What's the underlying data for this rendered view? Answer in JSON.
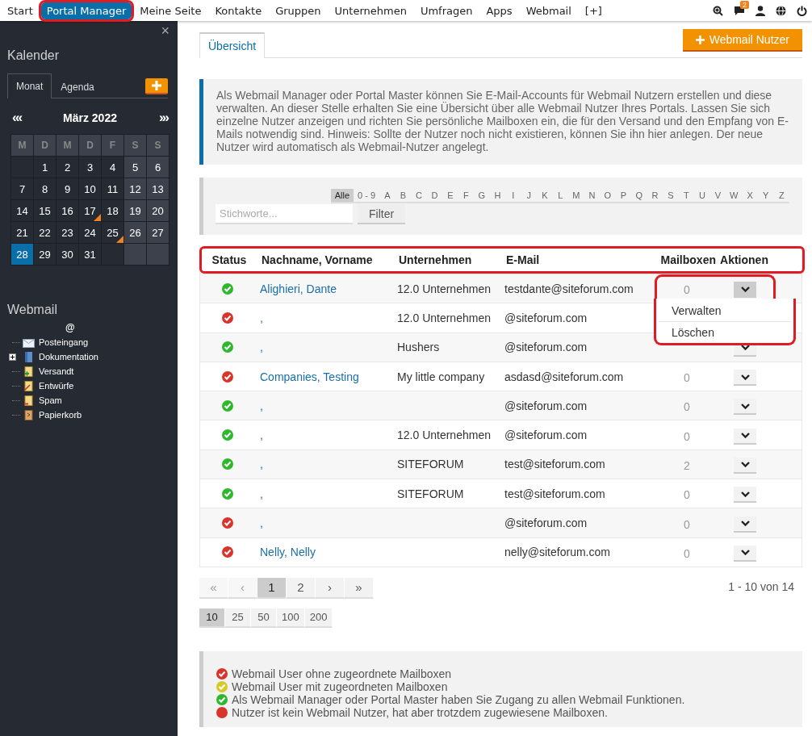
{
  "nav": {
    "items": [
      {
        "label": "Start",
        "selected": false
      },
      {
        "label": "Portal Manager",
        "selected": true,
        "highlighted": true
      },
      {
        "label": "Meine Seite",
        "selected": false
      },
      {
        "label": "Kontakte",
        "selected": false
      },
      {
        "label": "Gruppen",
        "selected": false
      },
      {
        "label": "Unternehmen",
        "selected": false
      },
      {
        "label": "Umfragen",
        "selected": false
      },
      {
        "label": "Apps",
        "selected": false
      },
      {
        "label": "Webmail",
        "selected": false
      },
      {
        "label": "[+]",
        "selected": false
      }
    ],
    "message_count": "2"
  },
  "sidebar": {
    "close": "×",
    "calendar": {
      "title": "Kalender",
      "tabs": [
        {
          "label": "Monat",
          "selected": true
        },
        {
          "label": "Agenda",
          "selected": false
        }
      ],
      "prev": "«‹",
      "month": "März 2022",
      "next": "›»",
      "weekdays": [
        "M",
        "D",
        "M",
        "D",
        "F",
        "S",
        "S"
      ],
      "weeks": [
        [
          {
            "kind": "blank"
          },
          {
            "kind": "day",
            "day": "1",
            "selected": false,
            "event": false
          },
          {
            "kind": "day",
            "day": "2",
            "selected": false,
            "event": false
          },
          {
            "kind": "day",
            "day": "3",
            "selected": false,
            "event": false
          },
          {
            "kind": "day",
            "day": "4",
            "selected": false,
            "event": false
          },
          {
            "kind": "day",
            "day": "5",
            "selected": false,
            "event": false
          },
          {
            "kind": "day",
            "day": "6",
            "selected": false,
            "event": false
          }
        ],
        [
          {
            "kind": "day",
            "day": "7",
            "selected": false,
            "event": false
          },
          {
            "kind": "day",
            "day": "8",
            "selected": false,
            "event": false
          },
          {
            "kind": "day",
            "day": "9",
            "selected": false,
            "event": false
          },
          {
            "kind": "day",
            "day": "10",
            "selected": false,
            "event": false
          },
          {
            "kind": "day",
            "day": "11",
            "selected": false,
            "event": false
          },
          {
            "kind": "day",
            "day": "12",
            "selected": false,
            "event": false
          },
          {
            "kind": "day",
            "day": "13",
            "selected": false,
            "event": false
          }
        ],
        [
          {
            "kind": "day",
            "day": "14",
            "selected": false,
            "event": false
          },
          {
            "kind": "day",
            "day": "15",
            "selected": false,
            "event": false
          },
          {
            "kind": "day",
            "day": "16",
            "selected": false,
            "event": false
          },
          {
            "kind": "day",
            "day": "17",
            "selected": false,
            "event": true
          },
          {
            "kind": "day",
            "day": "18",
            "selected": false,
            "event": false
          },
          {
            "kind": "day",
            "day": "19",
            "selected": false,
            "event": false
          },
          {
            "kind": "day",
            "day": "20",
            "selected": false,
            "event": false
          }
        ],
        [
          {
            "kind": "day",
            "day": "21",
            "selected": false,
            "event": false
          },
          {
            "kind": "day",
            "day": "22",
            "selected": false,
            "event": false
          },
          {
            "kind": "day",
            "day": "23",
            "selected": false,
            "event": false
          },
          {
            "kind": "day",
            "day": "24",
            "selected": false,
            "event": false
          },
          {
            "kind": "day",
            "day": "25",
            "selected": false,
            "event": true
          },
          {
            "kind": "day",
            "day": "26",
            "selected": false,
            "event": false
          },
          {
            "kind": "day",
            "day": "27",
            "selected": false,
            "event": false
          }
        ],
        [
          {
            "kind": "day",
            "day": "28",
            "selected": true,
            "event": false
          },
          {
            "kind": "day",
            "day": "29",
            "selected": false,
            "event": false
          },
          {
            "kind": "day",
            "day": "30",
            "selected": false,
            "event": false
          },
          {
            "kind": "day",
            "day": "31",
            "selected": false,
            "event": false
          },
          {
            "kind": "blank"
          },
          {
            "kind": "blank"
          },
          {
            "kind": "blank"
          }
        ]
      ]
    },
    "webmail": {
      "title": "Webmail",
      "root": "@",
      "folders": [
        {
          "label": "Posteingang",
          "kind": "inbox"
        },
        {
          "label": "Dokumentation",
          "kind": "docs",
          "expanded": false
        },
        {
          "label": "Versandt",
          "kind": "sent"
        },
        {
          "label": "Entwürfe",
          "kind": "drafts"
        },
        {
          "label": "Spam",
          "kind": "spam"
        },
        {
          "label": "Papierkorb",
          "kind": "trash"
        }
      ]
    }
  },
  "tabs": [
    {
      "label": "Übersicht",
      "selected": true
    }
  ],
  "add_button": "Webmail Nutzer",
  "description": "Als Webmail Manager oder Portal Master können Sie E-Mail-Accounts für Webmail Nutzern erstellen und diese verwalten. An dieser Stelle erhalten Sie eine Übersicht über alle Webmail Nutzer Ihres Portals. Lassen Sie sich einzelne Nutzer anzeigen und richten Sie persönliche Mailboxen ein, die für den Versand und den Empfang von E-Mails notwendig sind. Hinweis: Sollte der Nutzer noch nicht existieren, können Sie ihn hier anlegen. Der neue Nutzer wird automatisch als Webmail-Nutzer angelegt.",
  "alphabet": [
    {
      "label": "Alle",
      "selected": true
    },
    {
      "label": "0 - 9",
      "selected": false
    },
    {
      "label": "A",
      "selected": false
    },
    {
      "label": "B",
      "selected": false
    },
    {
      "label": "C",
      "selected": false
    },
    {
      "label": "D",
      "selected": false
    },
    {
      "label": "E",
      "selected": false
    },
    {
      "label": "F",
      "selected": false
    },
    {
      "label": "G",
      "selected": false
    },
    {
      "label": "H",
      "selected": false
    },
    {
      "label": "I",
      "selected": false
    },
    {
      "label": "J",
      "selected": false
    },
    {
      "label": "K",
      "selected": false
    },
    {
      "label": "L",
      "selected": false
    },
    {
      "label": "M",
      "selected": false
    },
    {
      "label": "N",
      "selected": false
    },
    {
      "label": "O",
      "selected": false
    },
    {
      "label": "P",
      "selected": false
    },
    {
      "label": "Q",
      "selected": false
    },
    {
      "label": "R",
      "selected": false
    },
    {
      "label": "S",
      "selected": false
    },
    {
      "label": "T",
      "selected": false
    },
    {
      "label": "U",
      "selected": false
    },
    {
      "label": "V",
      "selected": false
    },
    {
      "label": "W",
      "selected": false
    },
    {
      "label": "X",
      "selected": false
    },
    {
      "label": "Y",
      "selected": false
    },
    {
      "label": "Z",
      "selected": false
    }
  ],
  "search": {
    "placeholder": "Stichworte..."
  },
  "filter_button": "Filter",
  "table": {
    "columns": [
      "Status",
      "Nachname, Vorname",
      "Unternehmen",
      "E-Mail",
      "Mailboxen",
      "Aktionen"
    ],
    "rows": [
      {
        "color": "#2eb82e",
        "name": "Alighieri, Dante",
        "company": "12.0 Unternehmen",
        "email": "testdante@siteforum.com",
        "mailboxes": "0",
        "open": true
      },
      {
        "color": "#d9342b",
        "name": ",",
        "company": "12.0 Unternehmen",
        "email": "@siteforum.com"
      },
      {
        "color": "#2eb82e",
        "name": ",",
        "company": "Hushers",
        "email": "@siteforum.com"
      },
      {
        "color": "#d9342b",
        "name": "Companies, Testing",
        "company": "My little company",
        "email": "asdasd@siteforum.com",
        "mailboxes": "0"
      },
      {
        "color": "#2eb82e",
        "name": ",",
        "email": "@siteforum.com",
        "mailboxes": "0"
      },
      {
        "color": "#2eb82e",
        "name": ",",
        "company": "12.0 Unternehmen",
        "email": "@siteforum.com",
        "mailboxes": "0"
      },
      {
        "color": "#2eb82e",
        "name": ",",
        "company": "SITEFORUM",
        "email": "test@siteforum.com",
        "mailboxes": "2"
      },
      {
        "color": "#2eb82e",
        "name": ",",
        "company": "SITEFORUM",
        "email": "test@siteforum.com",
        "mailboxes": "0"
      },
      {
        "color": "#d9342b",
        "name": ",",
        "email": "@siteforum.com",
        "mailboxes": "0"
      },
      {
        "color": "#d9342b",
        "name": "Nelly, Nelly",
        "email": "nelly@siteforum.com",
        "mailboxes": "0"
      }
    ]
  },
  "action_menu": [
    "Verwalten",
    "Löschen"
  ],
  "pagination": {
    "pages": [
      {
        "label": "«",
        "disabled": true,
        "selected": false
      },
      {
        "label": "‹",
        "disabled": true,
        "selected": false
      },
      {
        "label": "1",
        "disabled": false,
        "selected": true
      },
      {
        "label": "2",
        "disabled": false,
        "selected": false
      },
      {
        "label": "›",
        "disabled": false,
        "selected": false
      },
      {
        "label": "»",
        "disabled": false,
        "selected": false
      }
    ],
    "summary": "1 - 10 von 14",
    "page_sizes": [
      {
        "label": "10",
        "selected": true
      },
      {
        "label": "25",
        "selected": false
      },
      {
        "label": "50",
        "selected": false
      },
      {
        "label": "100",
        "selected": false
      },
      {
        "label": "200",
        "selected": false
      }
    ]
  },
  "legend": [
    {
      "kind": "check",
      "color": "#d9342b",
      "text": "Webmail User ohne zugeordnete Mailboxen"
    },
    {
      "kind": "check",
      "color": "#d6c92a",
      "text": "Webmail User mit zugeordneten Mailboxen"
    },
    {
      "kind": "check",
      "color": "#2eb82e",
      "text": "Als Webmail Manager oder Portal Master haben Sie Zugang zu allen Webmail Funktionen."
    },
    {
      "kind": "dot",
      "color": "#d9342b",
      "text": "Nutzer ist kein Webmail Nutzer, hat aber trotzdem zugewiesene Mailboxen."
    }
  ]
}
